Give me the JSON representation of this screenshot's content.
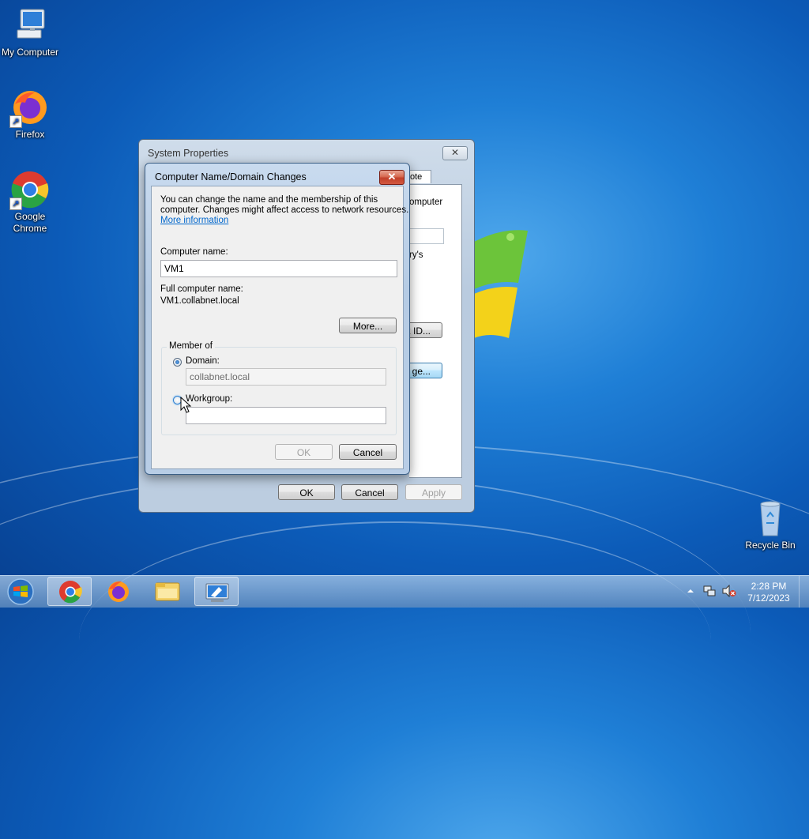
{
  "desktop": {
    "icons": [
      {
        "label": "My Computer",
        "icon": "computer-icon"
      },
      {
        "label": "Firefox",
        "icon": "firefox-icon"
      },
      {
        "label": "Google\nChrome",
        "icon": "chrome-icon"
      },
      {
        "label": "Recycle Bin",
        "icon": "recycle-bin-icon"
      }
    ]
  },
  "system_properties": {
    "title": "System Properties",
    "tab_partial": "ote",
    "text_computer": "omputer",
    "text_rys": "ry's",
    "button_network_id": "k ID...",
    "button_change": "ge...",
    "ok": "OK",
    "cancel": "Cancel",
    "apply": "Apply"
  },
  "dialog": {
    "title": "Computer Name/Domain Changes",
    "intro_line1": "You can change the name and the membership of this",
    "intro_line2": "computer. Changes might affect access to network resources.",
    "more_info_link": "More information",
    "computer_name_label": "Computer name:",
    "computer_name_value": "VM1",
    "full_name_label": "Full computer name:",
    "full_name_value": "VM1.collabnet.local",
    "more_button": "More...",
    "member_of_label": "Member of",
    "domain_label": "Domain:",
    "domain_value": "collabnet.local",
    "domain_selected": true,
    "workgroup_label": "Workgroup:",
    "workgroup_value": "",
    "ok": "OK",
    "cancel": "Cancel"
  },
  "taskbar": {
    "items": [
      "chrome-icon",
      "firefox-icon",
      "file-explorer-icon",
      "system-properties-icon"
    ],
    "active_item": "system-properties-icon",
    "tray_icons": [
      "show-hidden-icons-arrow",
      "network-icon",
      "volume-muted-icon"
    ],
    "time": "2:28 PM",
    "date": "7/12/2023"
  }
}
